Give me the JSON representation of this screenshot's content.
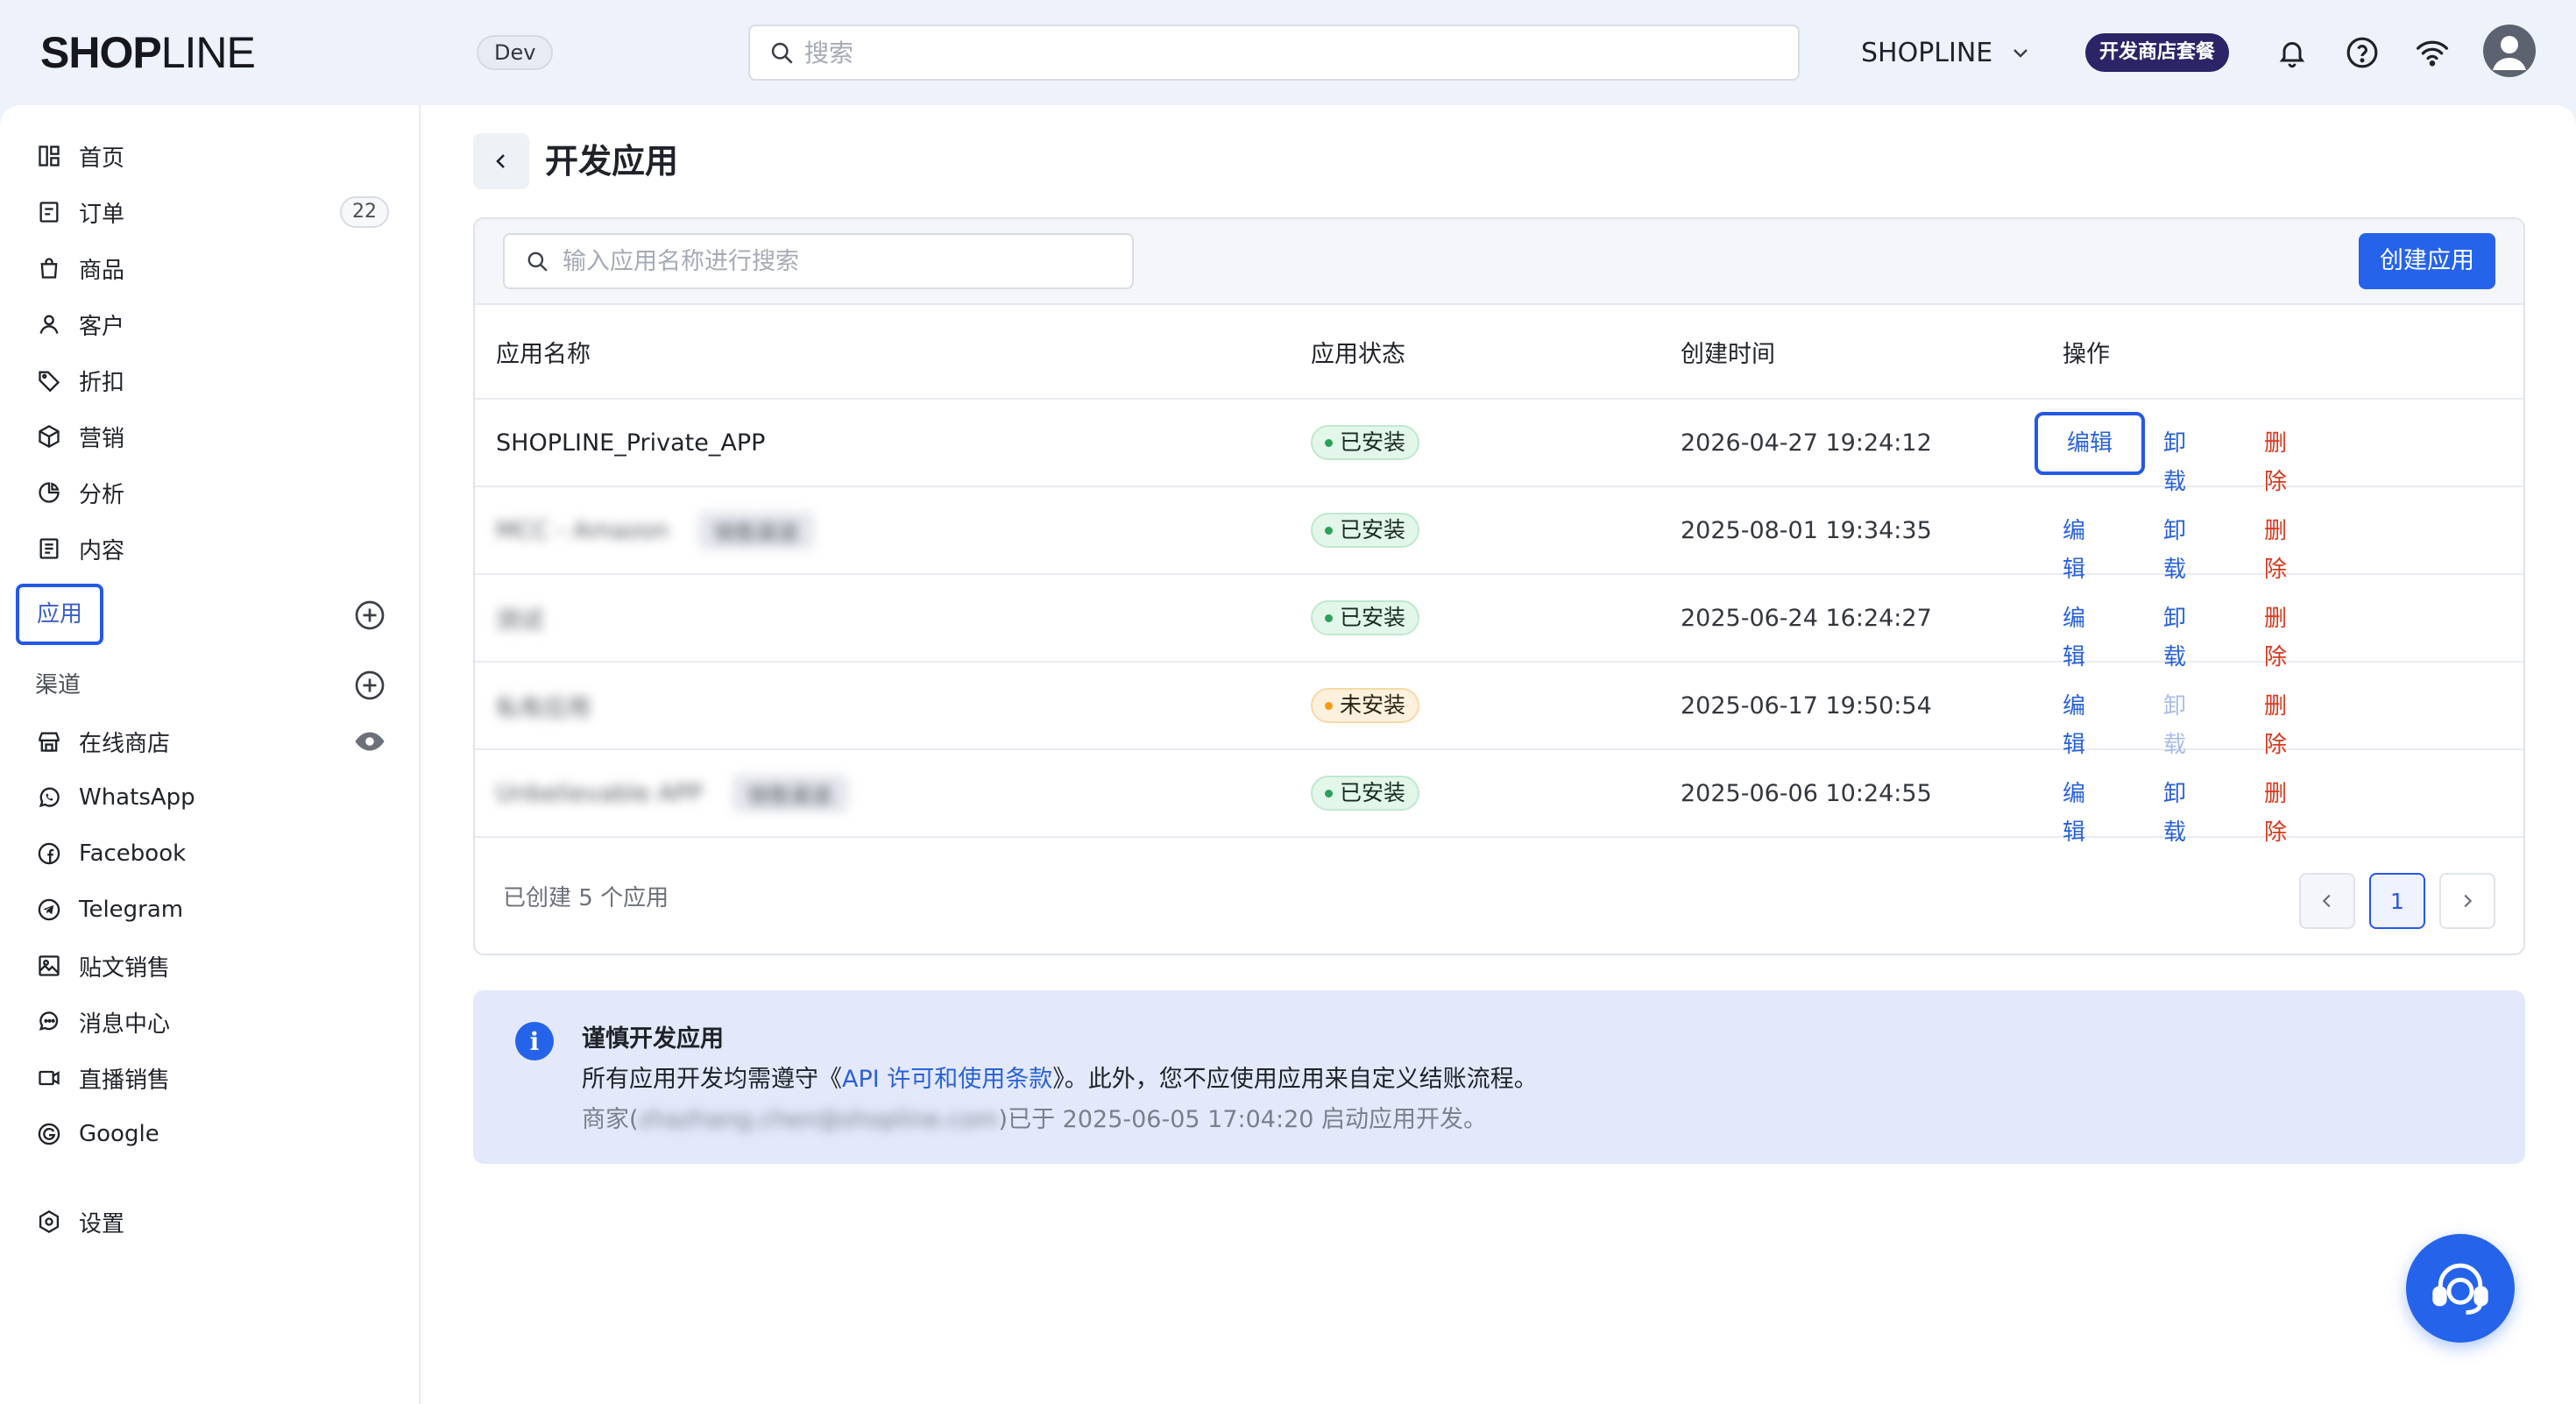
{
  "topbar": {
    "logo_bold": "SHOP",
    "logo_light": "LINE",
    "env_badge": "Dev",
    "search_placeholder": "搜索",
    "store_name": "SHOPLINE",
    "plan_badge": "开发商店套餐"
  },
  "sidebar": {
    "items": [
      {
        "label": "首页",
        "icon": "dashboard-icon"
      },
      {
        "label": "订单",
        "icon": "orders-icon",
        "count": "22"
      },
      {
        "label": "商品",
        "icon": "bag-icon"
      },
      {
        "label": "客户",
        "icon": "user-icon"
      },
      {
        "label": "折扣",
        "icon": "tag-icon"
      },
      {
        "label": "营销",
        "icon": "cube-icon"
      },
      {
        "label": "分析",
        "icon": "pie-chart-icon"
      },
      {
        "label": "内容",
        "icon": "document-icon"
      }
    ],
    "apps_label": "应用",
    "channels_label": "渠道",
    "channels": [
      {
        "label": "在线商店",
        "icon": "store-icon"
      },
      {
        "label": "WhatsApp",
        "icon": "whatsapp-icon"
      },
      {
        "label": "Facebook",
        "icon": "facebook-icon"
      },
      {
        "label": "Telegram",
        "icon": "telegram-icon"
      },
      {
        "label": "贴文销售",
        "icon": "image-icon"
      },
      {
        "label": "消息中心",
        "icon": "chat-icon"
      },
      {
        "label": "直播销售",
        "icon": "video-icon"
      },
      {
        "label": "Google",
        "icon": "google-icon"
      }
    ],
    "settings_label": "设置"
  },
  "page": {
    "title": "开发应用",
    "search_placeholder": "输入应用名称进行搜索",
    "create_button": "创建应用",
    "columns": [
      "应用名称",
      "应用状态",
      "创建时间",
      "操作"
    ],
    "rows": [
      {
        "name": "SHOPLINE_Private_APP",
        "tag": "",
        "status": "已安装",
        "status_type": "ok",
        "created": "2026-04-27 19:24:12",
        "uninstall_enabled": true,
        "blurred": false
      },
      {
        "name": "MCC - Amazon",
        "tag": "销售渠道",
        "status": "已安装",
        "status_type": "ok",
        "created": "2025-08-01 19:34:35",
        "uninstall_enabled": true,
        "blurred": true
      },
      {
        "name": "测试",
        "tag": "",
        "status": "已安装",
        "status_type": "ok",
        "created": "2025-06-24 16:24:27",
        "uninstall_enabled": true,
        "blurred": true
      },
      {
        "name": "私有应用",
        "tag": "",
        "status": "未安装",
        "status_type": "warn",
        "created": "2025-06-17 19:50:54",
        "uninstall_enabled": false,
        "blurred": true
      },
      {
        "name": "Unbelievable APP",
        "tag": "销售渠道",
        "status": "已安装",
        "status_type": "ok",
        "created": "2025-06-06 10:24:55",
        "uninstall_enabled": true,
        "blurred": true
      }
    ],
    "ops": {
      "edit": "编辑",
      "uninstall": "卸载",
      "delete": "删除"
    },
    "footer_count": "已创建 5 个应用",
    "current_page": "1"
  },
  "notice": {
    "title": "谨慎开发应用",
    "body_prefix": "所有应用开发均需遵守《",
    "body_link": "API 许可和使用条款",
    "body_suffix": "》。此外，您不应使用应用来自定义结账流程。",
    "meta_prefix": "商家(",
    "meta_email": "zhazhang.chen@shopline.com",
    "meta_suffix": ")已于 2025-06-05 17:04:20 启动应用开发。"
  },
  "colors": {
    "accent": "#2563eb",
    "danger": "#d6391b",
    "plan_badge_bg": "#2b2467"
  }
}
